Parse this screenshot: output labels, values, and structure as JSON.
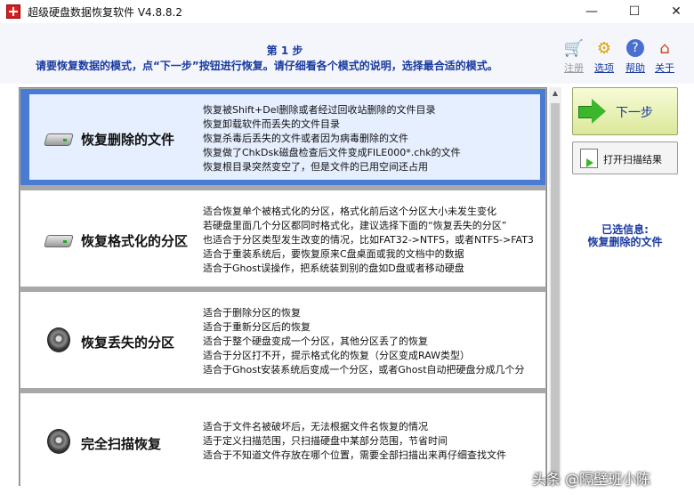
{
  "window": {
    "title": "超级硬盘数据恢复软件 V4.8.8.2",
    "minimize_glyph": "—",
    "maximize_glyph": "☐",
    "close_glyph": "✕"
  },
  "header": {
    "step_title": "第 1 步",
    "step_desc": "请要恢复数据的模式，点“下一步”按钮进行恢复。请仔细看各个模式的说明，选择最合适的模式。"
  },
  "top_tools": {
    "register": "注册",
    "options": "选项",
    "help": "帮助",
    "about": "关于"
  },
  "modes": [
    {
      "name": "恢复删除的文件",
      "icon": "drive-icon",
      "selected": true,
      "lines": [
        "恢复被Shift+Del删除或者经过回收站删除的文件目录",
        "恢复卸载软件而丢失的文件目录",
        "恢复杀毒后丢失的文件或者因为病毒删除的文件",
        "恢复做了ChkDsk磁盘检查后文件变成FILE000*.chk的文件",
        "恢复根目录突然变空了，但是文件的已用空间还占用"
      ]
    },
    {
      "name": "恢复格式化的分区",
      "icon": "drive-icon",
      "selected": false,
      "lines": [
        "适合恢复单个被格式化的分区，格式化前后这个分区大小未发生变化",
        "若硬盘里面几个分区都同时格式化，建议选择下面的“恢复丢失的分区”",
        "也适合于分区类型发生改变的情况，比如FAT32->NTFS，或者NTFS->FAT3",
        "适合于重装系统后，要恢复原来C盘桌面或我的文档中的数据",
        "适合于Ghost误操作，把系统装到别的盘如D盘或者移动硬盘"
      ]
    },
    {
      "name": "恢复丢失的分区",
      "icon": "hard-disk-icon",
      "selected": false,
      "lines": [
        "适合于删除分区的恢复",
        "适合于重新分区后的恢复",
        "适合于整个硬盘变成一个分区，其他分区丢了的恢复",
        "适合于分区打不开，提示格式化的恢复（分区变成RAW类型）",
        "适合于Ghost安装系统后变成一个分区，或者Ghost自动把硬盘分成几个分"
      ]
    },
    {
      "name": "完全扫描恢复",
      "icon": "hard-disk-icon",
      "selected": false,
      "lines": [
        "适合于文件名被破坏后，无法根据文件名恢复的情况",
        "适于定义扫描范围，只扫描硬盘中某部分范围，节省时间",
        "适合于不知道文件存放在哪个位置，需要全部扫描出来再仔细查找文件"
      ]
    }
  ],
  "side": {
    "next_label": "下一步",
    "open_scan_label": "打开扫描结果",
    "selected_info_title": "已选信息:",
    "selected_info_value": "恢复删除的文件"
  },
  "watermark": "头条 @隔壁班小陈",
  "colors": {
    "accent_blue": "#1a3aa0",
    "selected_border": "#4a7bd2",
    "next_button": "#dbe89a"
  }
}
